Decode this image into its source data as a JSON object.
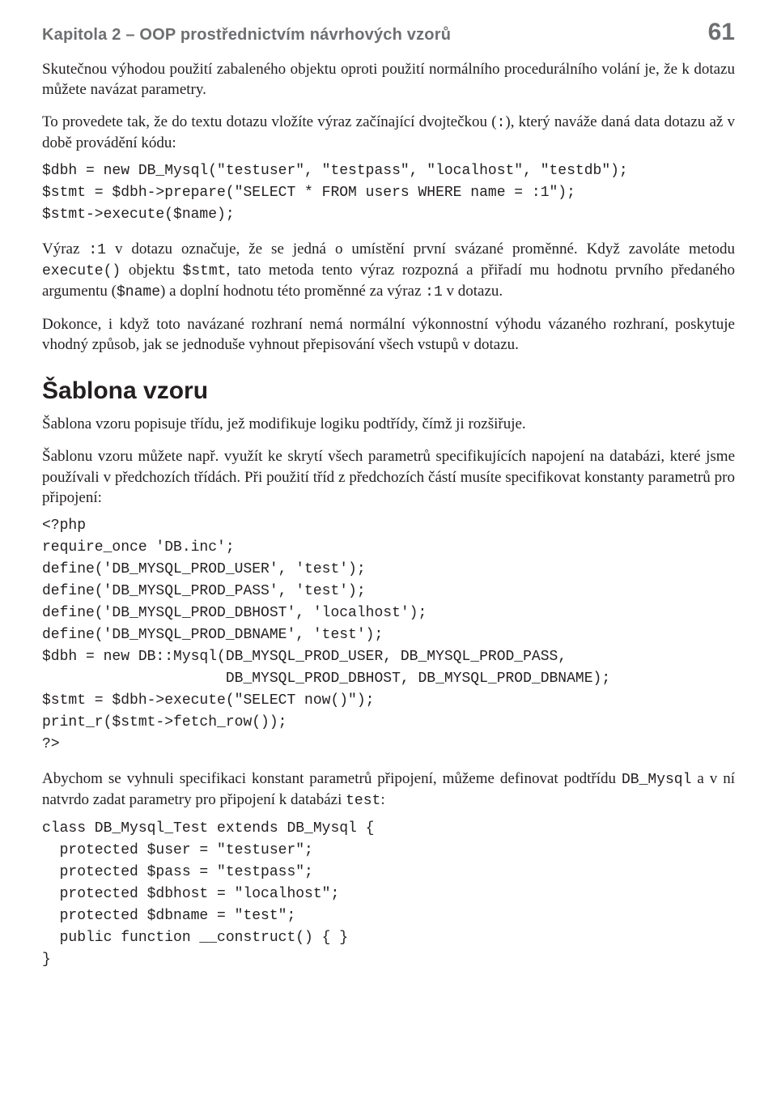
{
  "header": {
    "title": "Kapitola 2 – OOP prostřednictvím návrhových vzorů",
    "page": "61"
  },
  "intro_para": "Skutečnou výhodou použití zabaleného objektu oproti použití normálního procedurálního volání je, že k dotazu můžete navázat parametry.",
  "para_before_code1": "To provedete tak, že do textu dotazu vložíte výraz začínající dvojtečkou (",
  "colon_symbol": ":",
  "para_before_code1_b": "), který naváže daná data dotazu až v době provádění kódu:",
  "code_block_1": "$dbh = new DB_Mysql(\"testuser\", \"testpass\", \"localhost\", \"testdb\");\n$stmt = $dbh->prepare(\"SELECT * FROM users WHERE name = :1\");\n$stmt->execute($name);",
  "para_after_code1_a": "Výraz ",
  "inline_colon1": ":1",
  "para_after_code1_b": " v dotazu označuje, že se jedná o umístění první svázané proměnné. Když zavoláte metodu ",
  "inline_execute": "execute()",
  "para_after_code1_c": " objektu ",
  "inline_stmt": "$stmt",
  "para_after_code1_d": ", tato metoda tento výraz rozpozná a přiřadí mu hodnotu prvního předaného argumentu (",
  "inline_name": "$name",
  "para_after_code1_e": ") a doplní hodnotu této proměnné za výraz ",
  "inline_colon1b": ":1",
  "para_after_code1_f": " v dotazu.",
  "para_bound_iface": "Dokonce, i když toto navázané rozhraní nemá normální výkonnostní výhodu vázaného rozhraní, poskytuje vhodný způsob, jak se jednoduše vyhnout přepisování všech vstupů v dotazu.",
  "section_heading": "Šablona vzoru",
  "section_intro": "Šablona vzoru popisuje třídu, jež modifikuje logiku podtřídy, čímž ji rozšiřuje.",
  "section_p2": "Šablonu vzoru můžete např. využít ke skrytí všech parametrů specifikujících napojení na databázi, které jsme používali v předchozích třídách. Při použití tříd z předchozích částí musíte specifikovat konstanty parametrů pro připojení:",
  "code_block_2": "<?php\nrequire_once 'DB.inc';\ndefine('DB_MYSQL_PROD_USER', 'test');\ndefine('DB_MYSQL_PROD_PASS', 'test');\ndefine('DB_MYSQL_PROD_DBHOST', 'localhost');\ndefine('DB_MYSQL_PROD_DBNAME', 'test');\n$dbh = new DB::Mysql(DB_MYSQL_PROD_USER, DB_MYSQL_PROD_PASS,\n                     DB_MYSQL_PROD_DBHOST, DB_MYSQL_PROD_DBNAME);\n$stmt = $dbh->execute(\"SELECT now()\");\nprint_r($stmt->fetch_row());\n?>",
  "para_after_code2_a": "Abychom se vyhnuli specifikaci konstant parametrů připojení, můžeme definovat podtřídu ",
  "inline_dbmysql": "DB_Mysql",
  "para_after_code2_b": " a v ní natvrdo zadat parametry pro připojení k databázi ",
  "inline_test": "test",
  "para_after_code2_c": ":",
  "code_block_3": "class DB_Mysql_Test extends DB_Mysql {\n  protected $user = \"testuser\";\n  protected $pass = \"testpass\";\n  protected $dbhost = \"localhost\";\n  protected $dbname = \"test\";\n  public function __construct() { }\n}"
}
